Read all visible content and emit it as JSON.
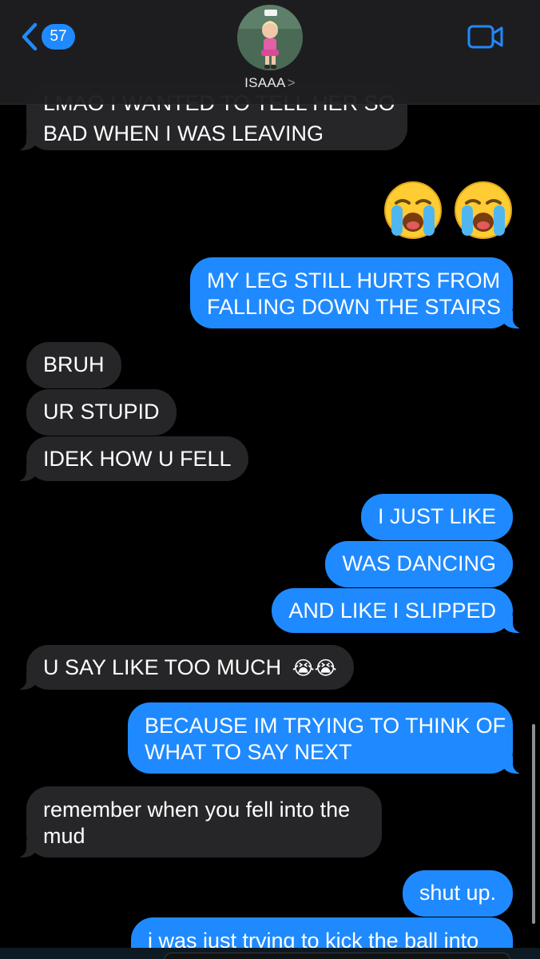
{
  "header": {
    "back_count": "57",
    "contact_name": "ISAAA",
    "chevron": ">",
    "icons": {
      "back": "chevron-left-icon",
      "video": "video-camera-icon",
      "avatar": "contact-avatar"
    },
    "accent_color": "#1f8aff"
  },
  "messages": [
    {
      "id": "m0",
      "type": "received",
      "text_lines": [
        "LMAO I WANTED TO TELL HER SO",
        "BAD WHEN I WAS LEAVING"
      ]
    },
    {
      "id": "m1",
      "type": "sent-emoji",
      "emoji": [
        "😭",
        "😭"
      ]
    },
    {
      "id": "m2",
      "type": "sent",
      "text_lines": [
        "MY LEG STILL HURTS FROM",
        "FALLING DOWN THE STAIRS"
      ]
    },
    {
      "id": "m3",
      "type": "received",
      "text": "BRUH"
    },
    {
      "id": "m4",
      "type": "received",
      "text": "UR STUPID"
    },
    {
      "id": "m5",
      "type": "received",
      "text": "IDEK HOW U FELL"
    },
    {
      "id": "m6",
      "type": "sent",
      "text": "I JUST LIKE"
    },
    {
      "id": "m7",
      "type": "sent",
      "text": "WAS DANCING"
    },
    {
      "id": "m8",
      "type": "sent",
      "text": "AND LIKE I SLIPPED"
    },
    {
      "id": "m9",
      "type": "received",
      "text": "U SAY LIKE TOO MUCH",
      "emoji": "😭😭"
    },
    {
      "id": "m10",
      "type": "sent",
      "text_lines": [
        "BECAUSE IM TRYING TO THINK OF",
        "WHAT TO SAY NEXT"
      ]
    },
    {
      "id": "m11",
      "type": "received",
      "text_lines": [
        "remember when you fell into the",
        "mud"
      ]
    },
    {
      "id": "m12",
      "type": "sent",
      "text": "shut up."
    },
    {
      "id": "m13",
      "type": "sent",
      "text": "i was just trying to kick the ball into"
    }
  ],
  "colors": {
    "sent_bubble": "#1f8aff",
    "received_bubble": "#262628",
    "background": "#000000"
  }
}
